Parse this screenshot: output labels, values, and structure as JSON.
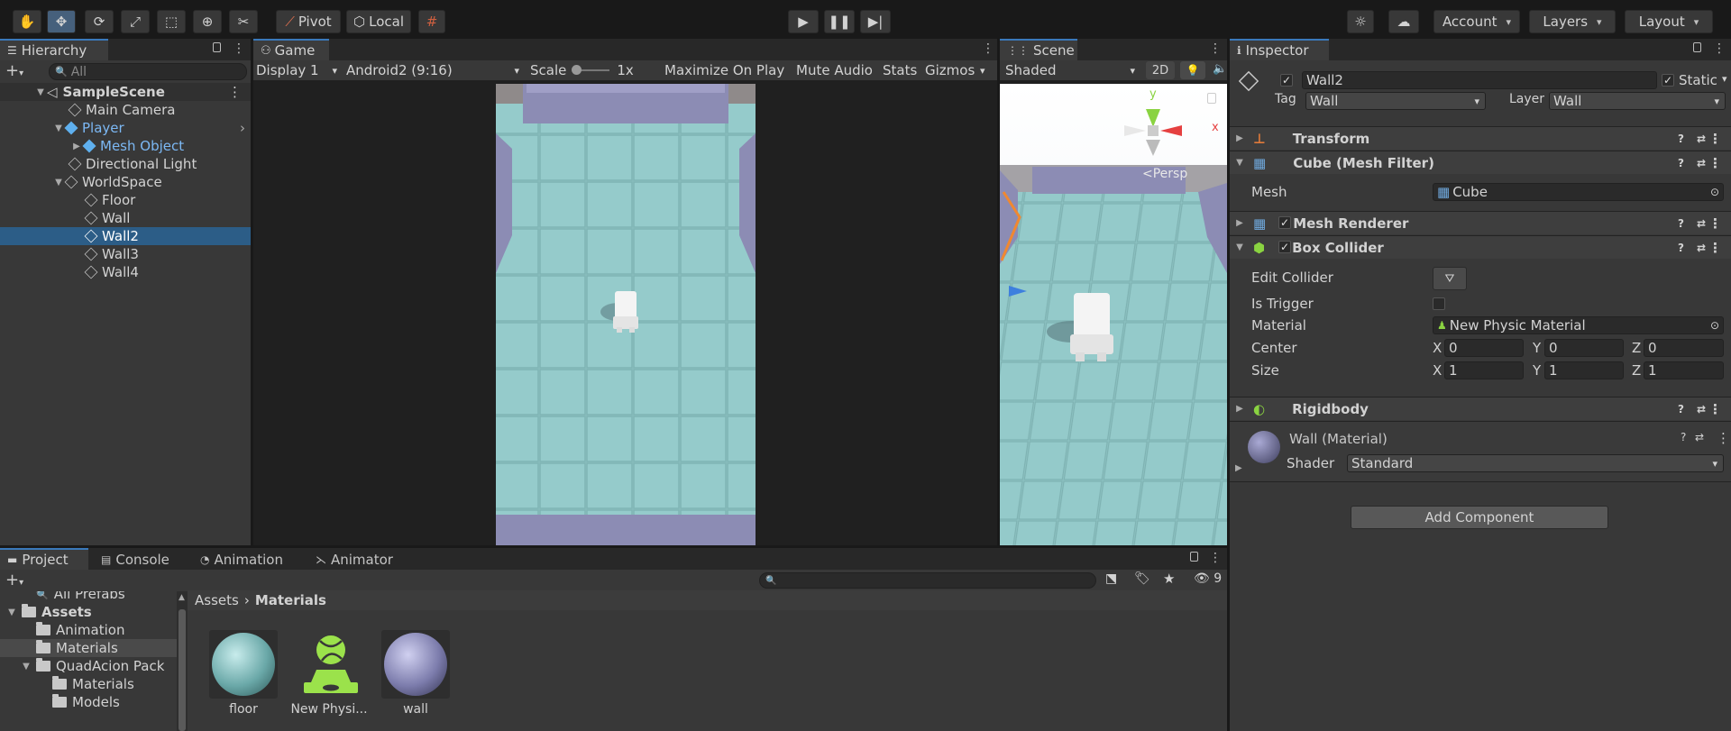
{
  "toolbar": {
    "pivot_label": "Pivot",
    "local_label": "Local",
    "account_label": "Account",
    "layers_label": "Layers",
    "layout_label": "Layout"
  },
  "hierarchy": {
    "tab_label": "Hierarchy",
    "search_placeholder": "All",
    "scene_name": "SampleScene",
    "items": [
      {
        "label": "Main Camera"
      },
      {
        "label": "Player"
      },
      {
        "label": "Mesh Object"
      },
      {
        "label": "Directional Light"
      },
      {
        "label": "WorldSpace"
      },
      {
        "label": "Floor"
      },
      {
        "label": "Wall"
      },
      {
        "label": "Wall2"
      },
      {
        "label": "Wall3"
      },
      {
        "label": "Wall4"
      }
    ]
  },
  "game": {
    "tab_label": "Game",
    "display": "Display 1",
    "aspect": "Android2 (9:16)",
    "scale_label": "Scale",
    "scale_value": "1x",
    "maximize_label": "Maximize On Play",
    "mute_label": "Mute Audio",
    "stats_label": "Stats",
    "gizmos_label": "Gizmos"
  },
  "scene": {
    "tab_label": "Scene",
    "shading": "Shaded",
    "mode_2d": "2D",
    "persp_label": "<Persp",
    "axis_y": "y",
    "axis_x": "x"
  },
  "inspector": {
    "tab_label": "Inspector",
    "object_name": "Wall2",
    "static_label": "Static",
    "tag_label": "Tag",
    "tag_value": "Wall",
    "layer_label": "Layer",
    "layer_value": "Wall",
    "components": {
      "transform": "Transform",
      "mesh_filter": "Cube (Mesh Filter)",
      "mesh_renderer": "Mesh Renderer",
      "box_collider": "Box Collider",
      "rigidbody": "Rigidbody"
    },
    "mesh_label": "Mesh",
    "mesh_value": "Cube",
    "edit_collider_label": "Edit Collider",
    "is_trigger_label": "Is Trigger",
    "material_label": "Material",
    "material_value": "New Physic Material",
    "center_label": "Center",
    "center": {
      "x": "0",
      "y": "0",
      "z": "0"
    },
    "size_label": "Size",
    "size": {
      "x": "1",
      "y": "1",
      "z": "1"
    },
    "axis_labels": {
      "x": "X",
      "y": "Y",
      "z": "Z"
    },
    "material_name": "Wall (Material)",
    "shader_label": "Shader",
    "shader_value": "Standard",
    "add_component_label": "Add Component"
  },
  "project": {
    "tabs": [
      {
        "label": "Project"
      },
      {
        "label": "Console"
      },
      {
        "label": "Animation"
      },
      {
        "label": "Animator"
      }
    ],
    "hidden_count": "9",
    "tree": [
      {
        "label": "All Prefabs"
      },
      {
        "label": "Assets"
      },
      {
        "label": "Animation"
      },
      {
        "label": "Materials"
      },
      {
        "label": "QuadAcion Pack"
      },
      {
        "label": "Materials"
      },
      {
        "label": "Models"
      }
    ],
    "breadcrumb": {
      "root": "Assets",
      "current": "Materials"
    },
    "assets": [
      {
        "label": "floor"
      },
      {
        "label": "New Physi..."
      },
      {
        "label": "wall"
      }
    ]
  },
  "colors": {
    "accent_blue": "#3a79bb",
    "selection": "#2c5d87",
    "panel_bg": "#383838",
    "floor_teal": "#8fc5c5",
    "wall_purple": "#8c8cb4",
    "physic_green": "#9be24b"
  }
}
